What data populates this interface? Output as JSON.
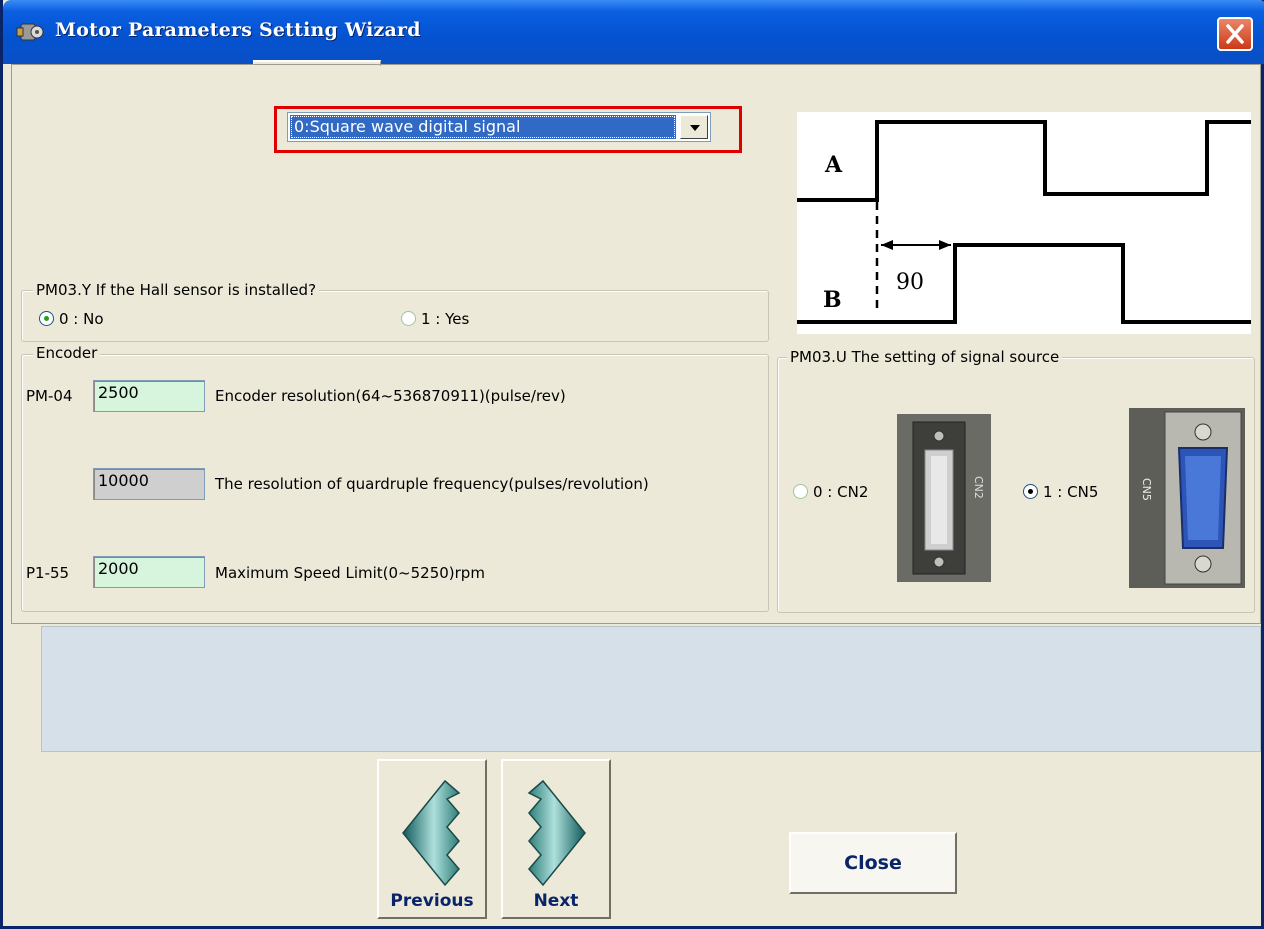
{
  "window": {
    "title": "Motor Parameters Setting Wizard"
  },
  "signal_type": {
    "selected": "0:Square wave digital signal"
  },
  "waveform": {
    "label_a": "A",
    "label_b": "B",
    "phase": "90"
  },
  "hall_sensor": {
    "title": "PM03.Y If the Hall sensor is installed?",
    "option_no": "0 : No",
    "option_yes": "1 : Yes",
    "selected": "0 : No"
  },
  "encoder": {
    "title": "Encoder",
    "row1": {
      "code": "PM-04",
      "value": "2500",
      "desc": "Encoder resolution(64~536870911)(pulse/rev)"
    },
    "row2": {
      "value": "10000",
      "desc": "The resolution of quardruple frequency(pulses/revolution)"
    },
    "row3": {
      "code": "P1-55",
      "value": "2000",
      "desc": "Maximum Speed Limit(0~5250)rpm"
    }
  },
  "signal_source": {
    "title": "PM03.U The setting of signal source",
    "option_cn2": "0 : CN2",
    "option_cn5": "1 : CN5",
    "cn2_label": "CN2",
    "cn5_label": "CN5",
    "selected": "1 : CN5"
  },
  "nav": {
    "previous": "Previous",
    "next": "Next",
    "close": "Close"
  },
  "colors": {
    "titlebar": "#0453d2",
    "highlight_box": "#e00000",
    "input_bg": "#d6f5dc",
    "message_area": "#d6e0e8"
  }
}
